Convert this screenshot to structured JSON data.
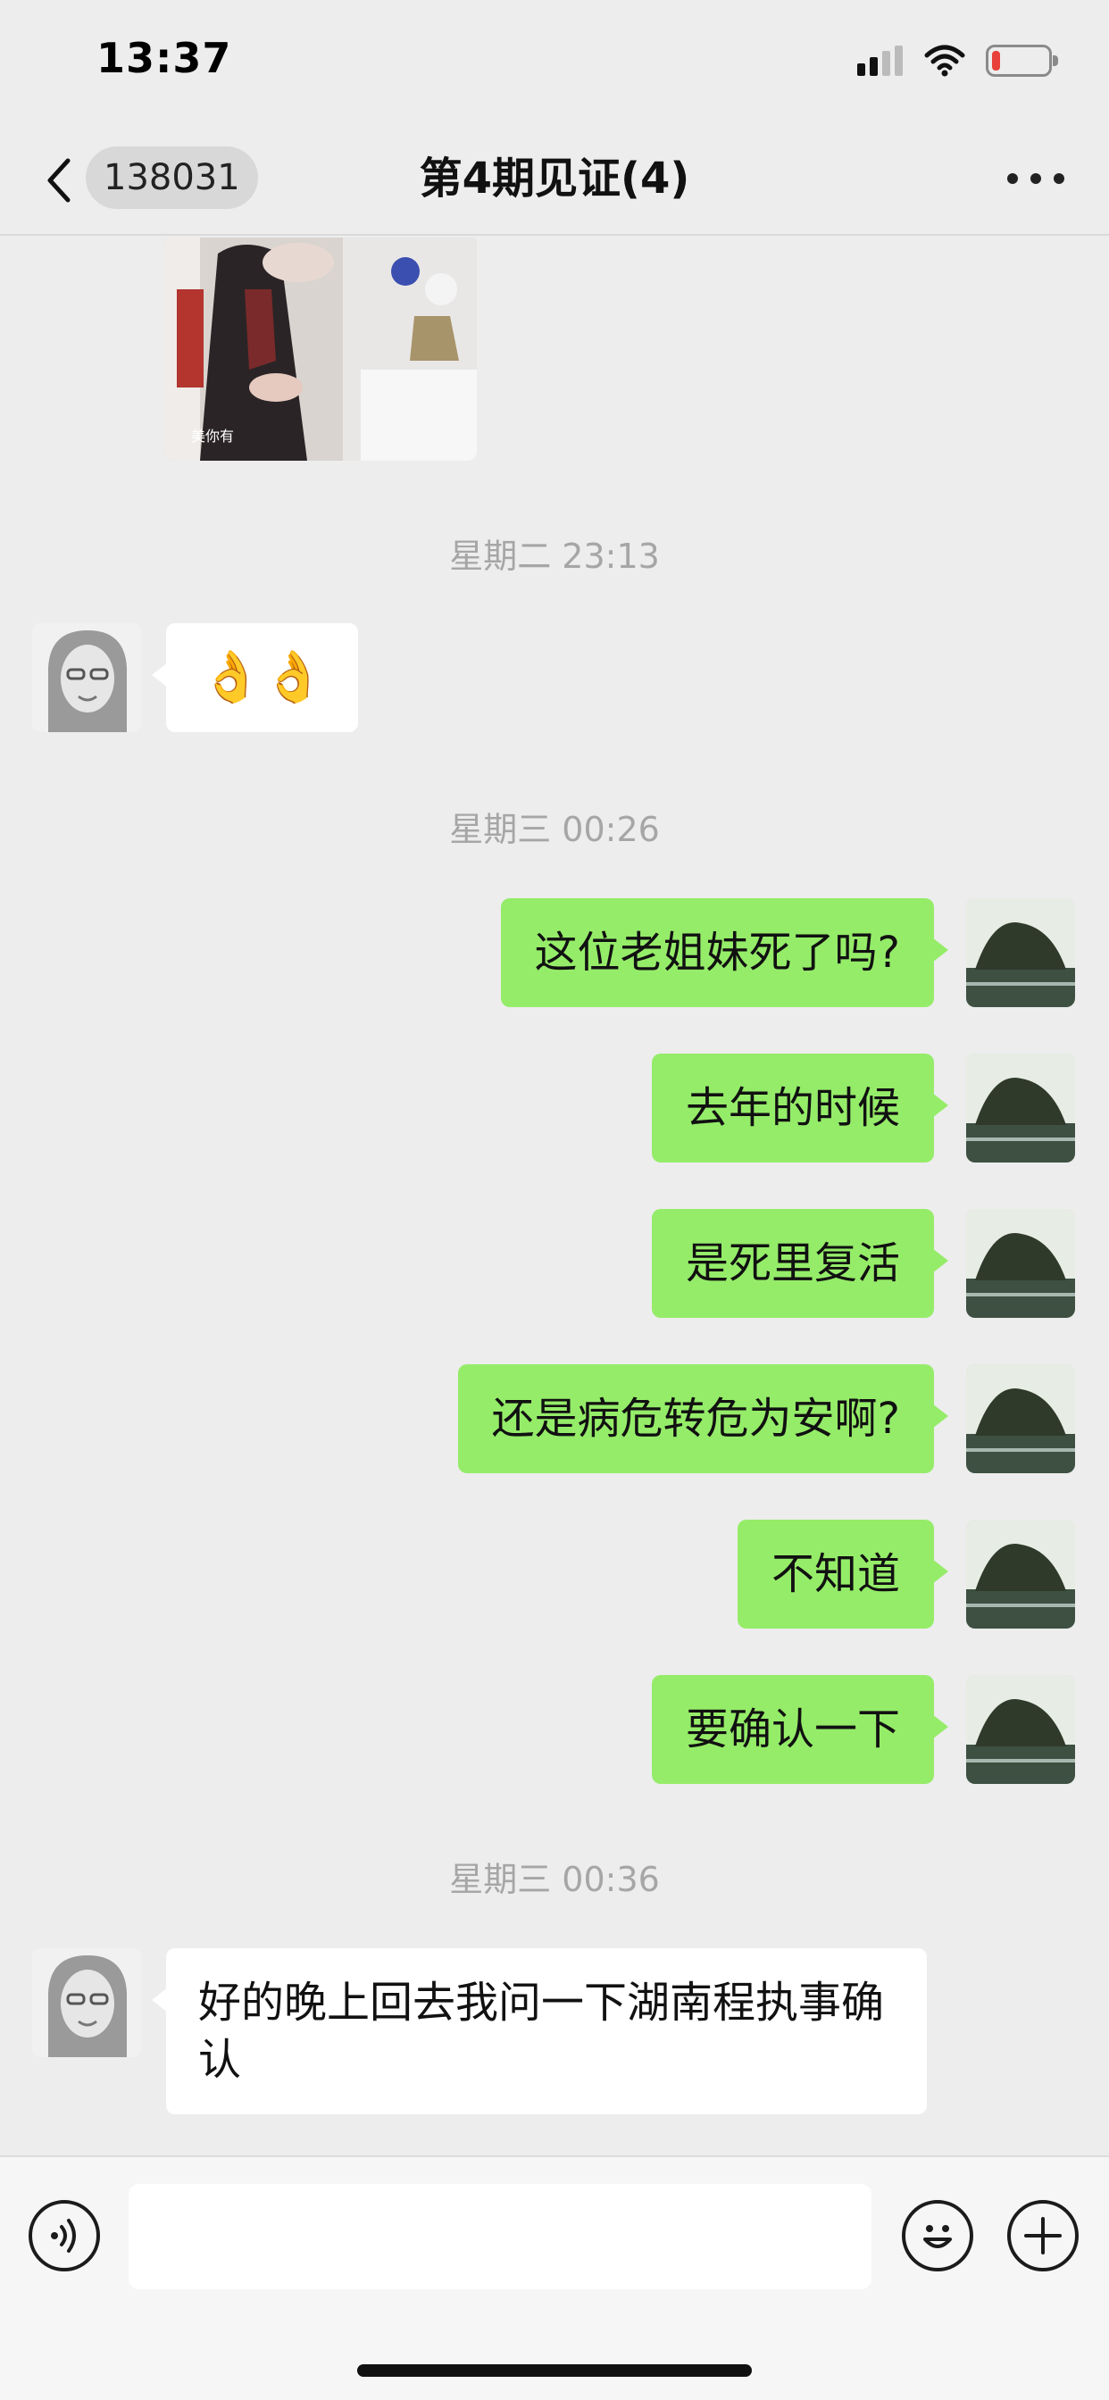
{
  "status_bar": {
    "time": "13:37",
    "icons": [
      "signal-icon",
      "wifi-icon",
      "battery-low-icon"
    ],
    "battery_level": 0.15,
    "battery_color": "#e8413a"
  },
  "nav": {
    "back_badge": "138031",
    "title": "第4期见证(4)",
    "icons": [
      "back-chevron-icon",
      "more-icon"
    ]
  },
  "messages": {
    "time_1": "星期二 23:13",
    "emoji_1": "👌👌",
    "time_2": "星期三 00:26",
    "sent": [
      "这位老姐妹死了吗?",
      "去年的时候",
      "是死里复活",
      "还是病危转危为安啊?",
      "不知道",
      "要确认一下"
    ],
    "time_3": "星期三 00:36",
    "received_last": "好的晚上回去我问一下湖南程执事确认"
  },
  "colors": {
    "sent_bubble": "#95ec69",
    "received_bubble": "#ffffff",
    "background": "#ededed"
  },
  "input_bar": {
    "icons": [
      "voice-icon",
      "emoji-icon",
      "plus-icon"
    ],
    "value": ""
  }
}
